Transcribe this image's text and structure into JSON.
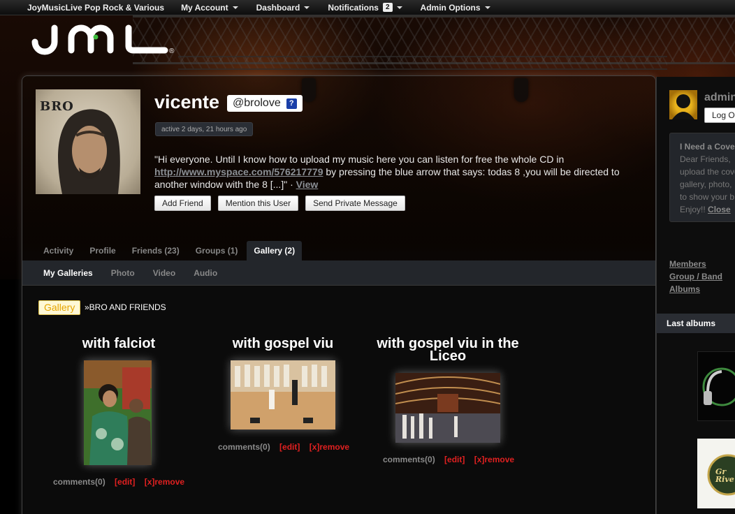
{
  "topnav": {
    "site_name": "JoyMusicLive Pop Rock & Various",
    "my_account": "My Account",
    "dashboard": "Dashboard",
    "notifications": "Notifications",
    "notification_count": "2",
    "admin_options": "Admin Options"
  },
  "logo": {
    "text": "JML"
  },
  "profile": {
    "avatar_text": "BRO",
    "name": "vicente",
    "handle": "@brolove",
    "handle_help": "?",
    "active": "active 2 days, 21 hours ago",
    "bio_pre": "\"Hi everyone. Until I know how to upload my music here you can listen for free the whole CD in ",
    "bio_link": "http://www.myspace.com/576217779",
    "bio_post": " by pressing the blue arrow that says: todas 8 ,you will be directed to another window with the 8 [...]\" · ",
    "bio_view": "View",
    "add_friend": "Add Friend",
    "mention": "Mention this User",
    "private_message": "Send Private Message"
  },
  "tabs": [
    {
      "label": "Activity"
    },
    {
      "label": "Profile"
    },
    {
      "label": "Friends (23)"
    },
    {
      "label": "Groups (1)"
    },
    {
      "label": "Gallery (2)"
    }
  ],
  "subtabs": [
    {
      "label": "My Galleries"
    },
    {
      "label": "Photo"
    },
    {
      "label": "Video"
    },
    {
      "label": "Audio"
    }
  ],
  "gallery": {
    "tag": "Gallery",
    "breadcrumb": "»BRO AND FRIENDS",
    "albums": [
      {
        "title": "with falciot",
        "comments": "comments(0)",
        "edit": "[edit]",
        "remove": "[x]remove"
      },
      {
        "title": "with gospel viu",
        "comments": "comments(0)",
        "edit": "[edit]",
        "remove": "[x]remove"
      },
      {
        "title": "with gospel viu in the Liceo",
        "comments": "comments(0)",
        "edit": "[edit]",
        "remove": "[x]remove"
      }
    ]
  },
  "sidebar": {
    "user": "admin",
    "logout": "Log Out",
    "notice_title": "I Need a Cover",
    "notice_lines": [
      "Dear Friends, ",
      "upload the cove",
      "gallery, photo, ",
      "to show your b",
      "Enjoy!! "
    ],
    "notice_close": "Close",
    "links": [
      "Members",
      "Group / Band",
      "Albums"
    ],
    "last_albums": "Last albums",
    "album2_text": "Gr Rive"
  }
}
